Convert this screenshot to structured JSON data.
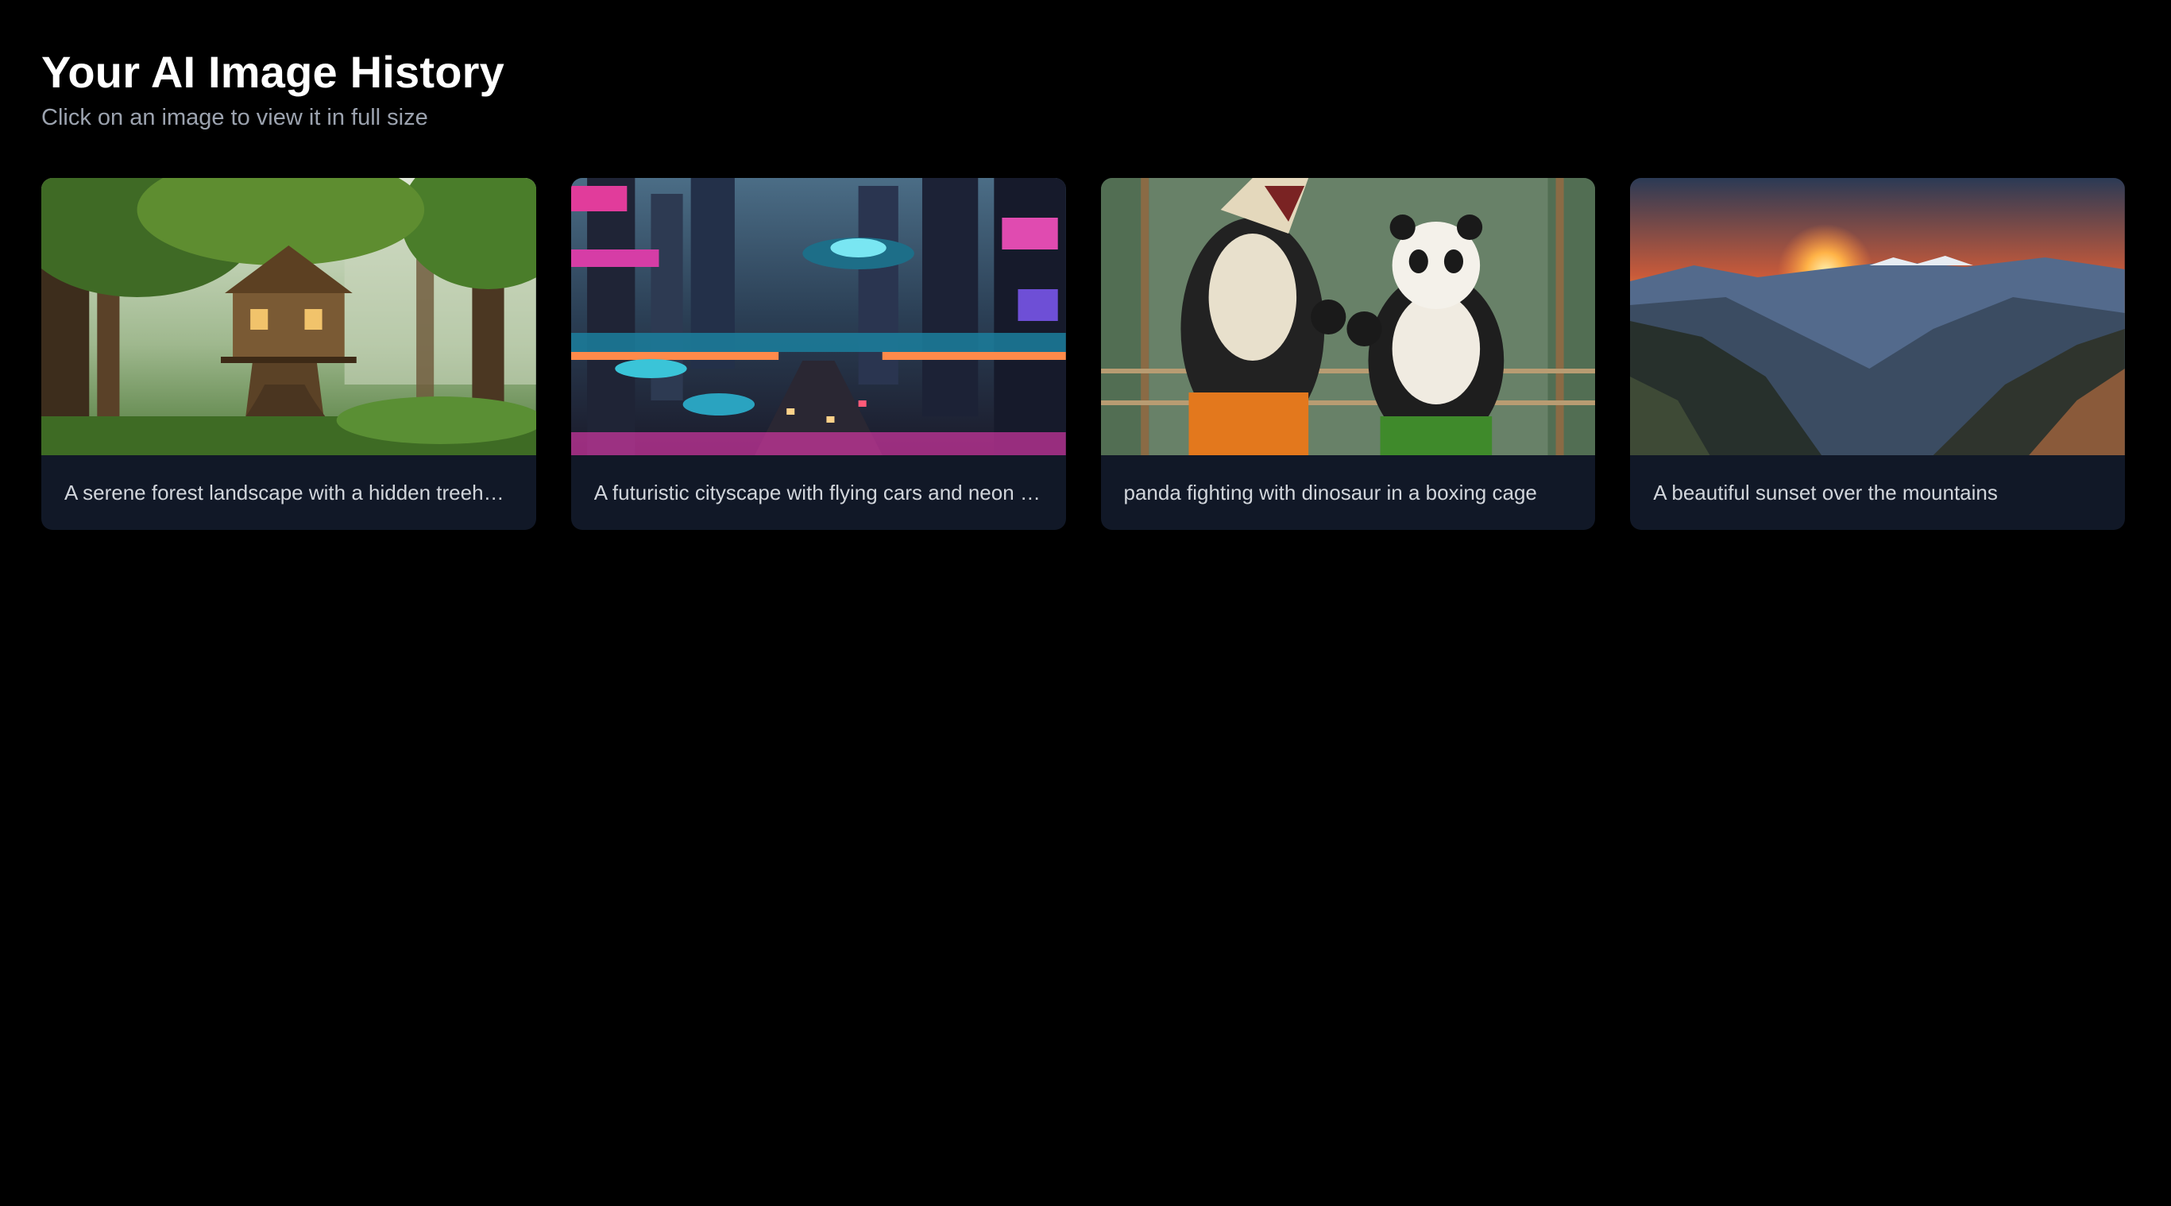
{
  "header": {
    "title": "Your AI Image History",
    "subtitle": "Click on an image to view it in full size"
  },
  "gallery": {
    "items": [
      {
        "caption": "A serene forest landscape with a hidden treehouse",
        "image_icon": "forest-treehouse-image"
      },
      {
        "caption": "A futuristic cityscape with flying cars and neon lights",
        "image_icon": "futuristic-city-image"
      },
      {
        "caption": "panda fighting with dinosaur in a boxing cage",
        "image_icon": "panda-dinosaur-boxing-image"
      },
      {
        "caption": "A beautiful sunset over the mountains",
        "image_icon": "mountain-sunset-image"
      }
    ]
  }
}
